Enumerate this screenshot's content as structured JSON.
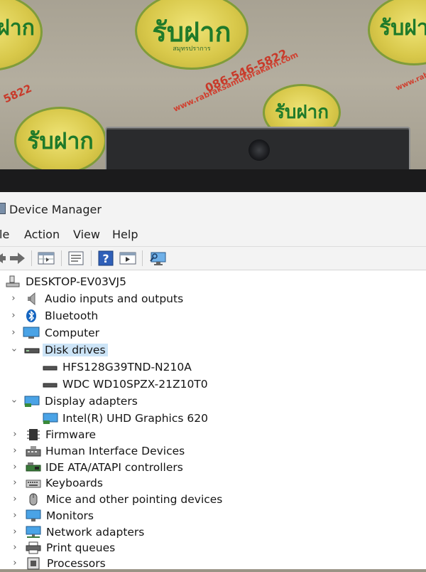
{
  "backdrop": {
    "brand": "รับฝาก",
    "brand_sub": "สมุทรปราการ",
    "website": "www.rabfaksamutprakarn.com",
    "phone": "086-546-5822",
    "phone_fragment": "5822",
    "colors": {
      "badge": "#d8c84a",
      "brand_text": "#1f7a2a",
      "url_text": "#d04030"
    }
  },
  "window": {
    "title": "Device Manager",
    "icon": "device-manager-icon"
  },
  "menu": {
    "file": "le",
    "action": "Action",
    "view": "View",
    "help": "Help"
  },
  "toolbar": {
    "buttons": [
      "back-icon",
      "forward-icon",
      "properties-grid-icon",
      "show-hidden-icon",
      "help-icon",
      "run-icon",
      "monitor-scan-icon"
    ]
  },
  "tree": {
    "root": "DESKTOP-EV03VJ5",
    "items": [
      {
        "label": "Audio inputs and outputs",
        "icon": "speaker-icon",
        "expanded": false
      },
      {
        "label": "Bluetooth",
        "icon": "bluetooth-icon",
        "expanded": false
      },
      {
        "label": "Computer",
        "icon": "computer-icon",
        "expanded": false
      },
      {
        "label": "Disk drives",
        "icon": "disk-drive-icon",
        "expanded": true,
        "children": [
          "HFS128G39TND-N210A",
          "WDC WD10SPZX-21Z10T0"
        ]
      },
      {
        "label": "Display adapters",
        "icon": "display-adapter-icon",
        "expanded": true,
        "children": [
          "Intel(R) UHD Graphics 620"
        ]
      },
      {
        "label": "Firmware",
        "icon": "firmware-icon",
        "expanded": false
      },
      {
        "label": "Human Interface Devices",
        "icon": "hid-icon",
        "expanded": false
      },
      {
        "label": "IDE ATA/ATAPI controllers",
        "icon": "ide-controller-icon",
        "expanded": false
      },
      {
        "label": "Keyboards",
        "icon": "keyboard-icon",
        "expanded": false
      },
      {
        "label": "Mice and other pointing devices",
        "icon": "mouse-icon",
        "expanded": false
      },
      {
        "label": "Monitors",
        "icon": "monitor-icon",
        "expanded": false
      },
      {
        "label": "Network adapters",
        "icon": "network-adapter-icon",
        "expanded": false
      },
      {
        "label": "Print queues",
        "icon": "printer-icon",
        "expanded": false
      },
      {
        "label": "Processors",
        "icon": "processor-icon",
        "expanded": false
      }
    ]
  }
}
